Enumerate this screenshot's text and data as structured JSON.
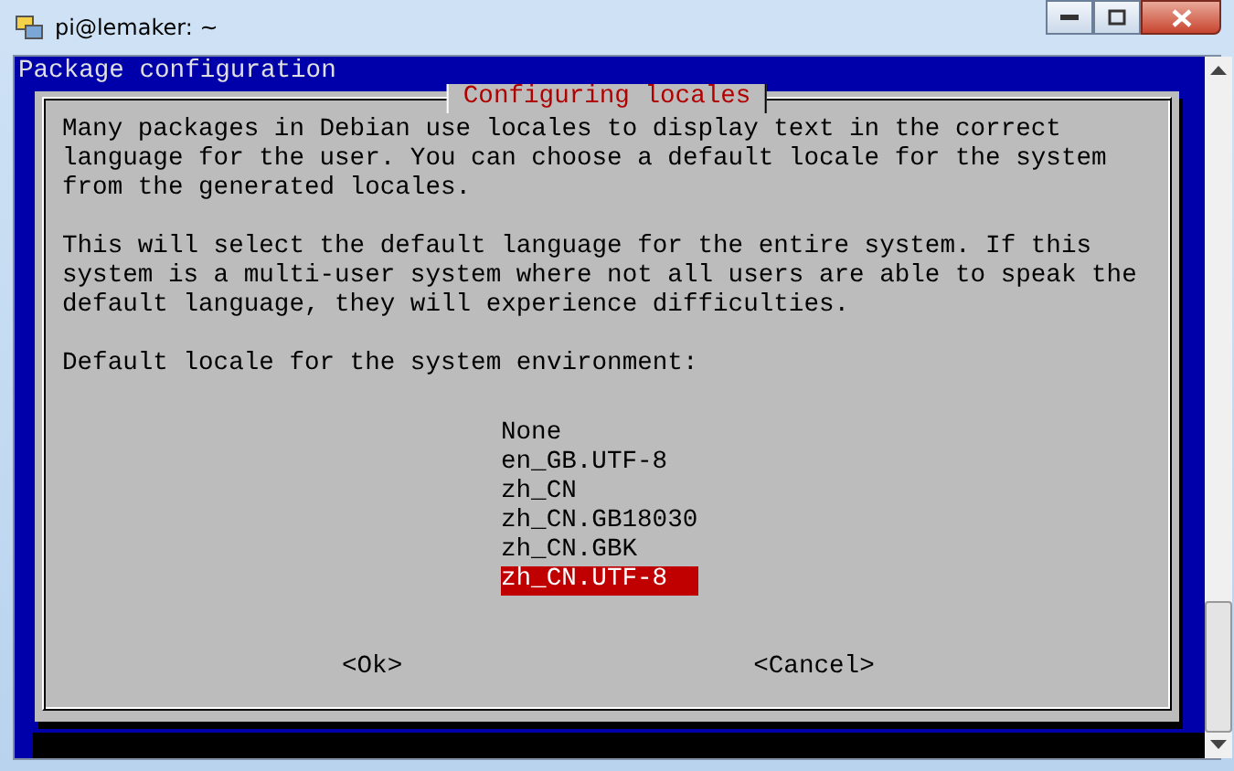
{
  "window": {
    "title": "pi@lemaker: ~"
  },
  "terminal": {
    "header": "Package configuration"
  },
  "dialog": {
    "title": "Configuring locales",
    "paragraphs": [
      "Many packages in Debian use locales to display text in the correct language for the user. You can choose a default locale for the system from the generated locales.",
      "This will select the default language for the entire system. If this system is a multi-user system where not all users are able to speak the default language, they will experience difficulties."
    ],
    "prompt": "Default locale for the system environment:",
    "options": [
      {
        "label": "None",
        "selected": false
      },
      {
        "label": "en_GB.UTF-8",
        "selected": false
      },
      {
        "label": "zh_CN",
        "selected": false
      },
      {
        "label": "zh_CN.GB18030",
        "selected": false
      },
      {
        "label": "zh_CN.GBK",
        "selected": false
      },
      {
        "label": "zh_CN.UTF-8",
        "selected": true
      }
    ],
    "buttons": [
      "<Ok>",
      "<Cancel>"
    ]
  }
}
